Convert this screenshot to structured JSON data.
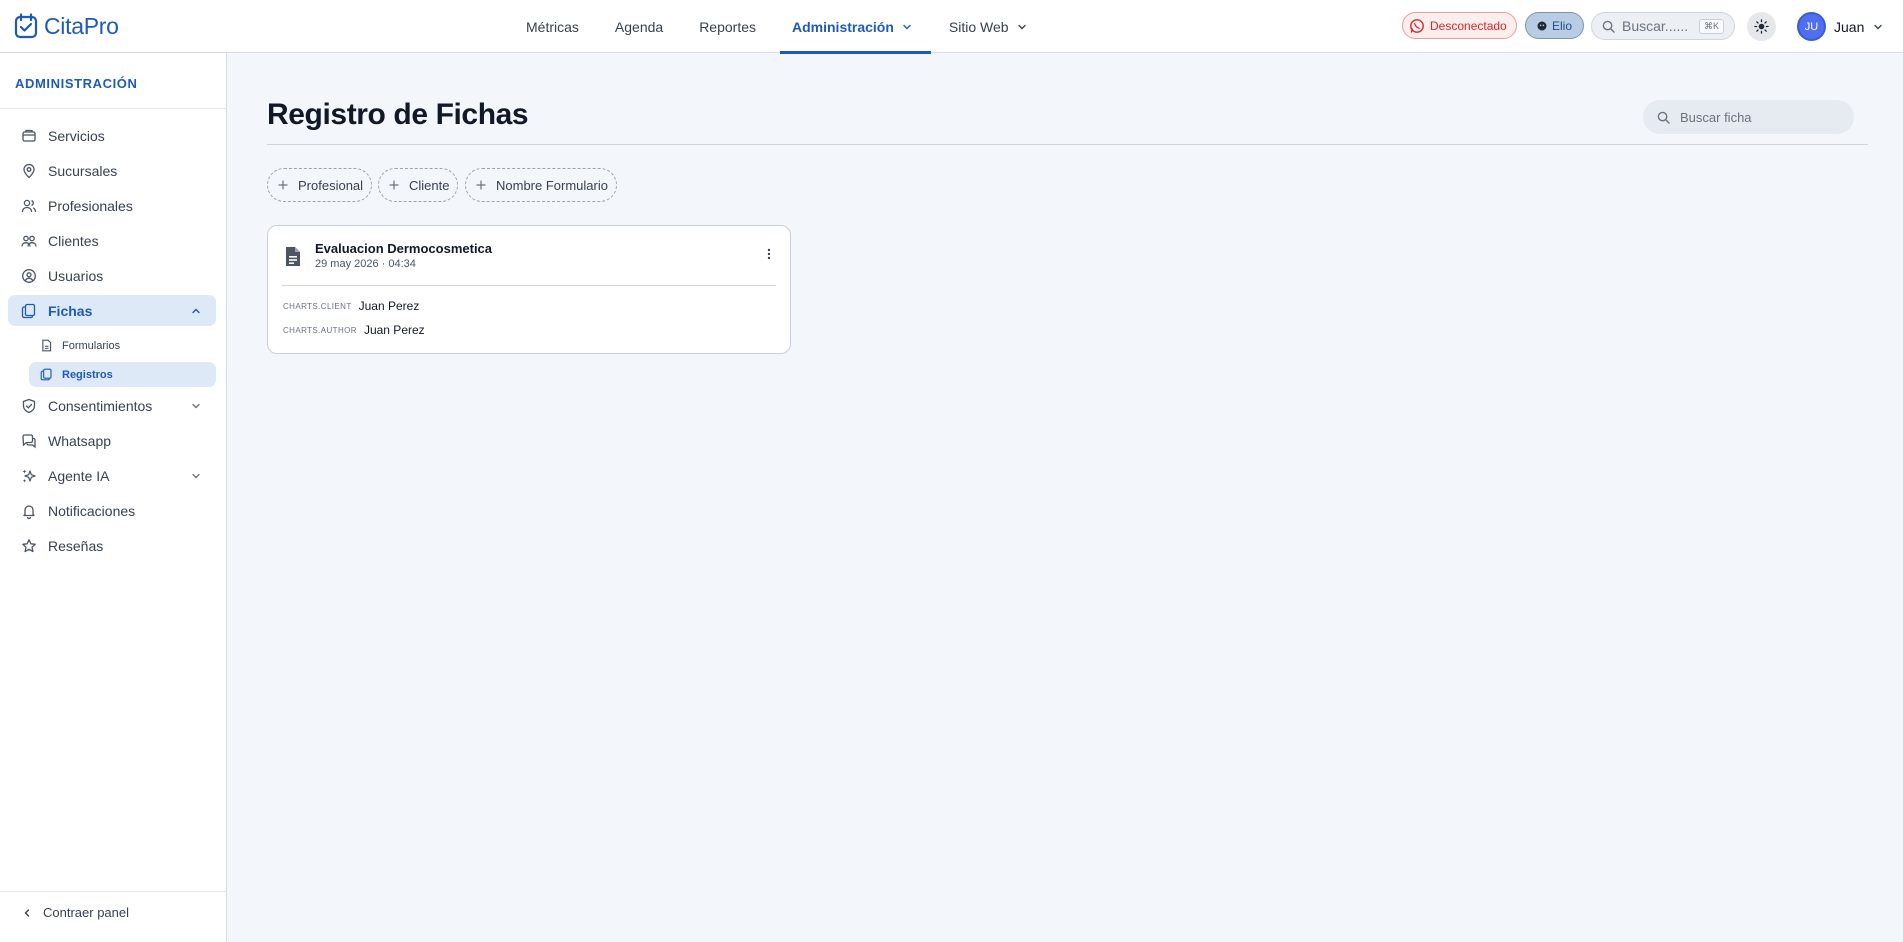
{
  "app": {
    "name": "CitaPro"
  },
  "nav": {
    "items": [
      {
        "label": "Métricas"
      },
      {
        "label": "Agenda"
      },
      {
        "label": "Reportes"
      },
      {
        "label": "Administración"
      },
      {
        "label": "Sitio Web"
      }
    ],
    "active": "Administración"
  },
  "header": {
    "whatsapp_status": "Desconectado",
    "assistant_label": "Elio",
    "search_placeholder": "Buscar......",
    "search_shortcut": "⌘K",
    "user_initials": "JU",
    "user_name": "Juan"
  },
  "sidebar": {
    "title": "ADMINISTRACIÓN",
    "items": [
      {
        "label": "Servicios",
        "icon": "box-icon"
      },
      {
        "label": "Sucursales",
        "icon": "location-icon"
      },
      {
        "label": "Profesionales",
        "icon": "users-icon"
      },
      {
        "label": "Clientes",
        "icon": "clients-icon"
      },
      {
        "label": "Usuarios",
        "icon": "user-circle-icon"
      },
      {
        "label": "Fichas",
        "icon": "files-icon",
        "active": true,
        "expanded": true
      },
      {
        "label": "Consentimientos",
        "icon": "shield-check-icon"
      },
      {
        "label": "Whatsapp",
        "icon": "chat-icon"
      },
      {
        "label": "Agente IA",
        "icon": "sparkles-icon"
      },
      {
        "label": "Notificaciones",
        "icon": "bell-icon"
      },
      {
        "label": "Reseñas",
        "icon": "star-icon"
      }
    ],
    "sub_items": [
      {
        "label": "Formularios",
        "icon": "file-icon"
      },
      {
        "label": "Registros",
        "icon": "files-icon",
        "active": true
      }
    ],
    "collapse_label": "Contraer panel"
  },
  "main": {
    "title": "Registro de Fichas",
    "search_placeholder": "Buscar ficha",
    "filters": [
      {
        "label": "Profesional"
      },
      {
        "label": "Cliente"
      },
      {
        "label": "Nombre Formulario"
      }
    ],
    "records": [
      {
        "title": "Evaluacion Dermocosmetica",
        "date": "29 may 2026 · 04:34",
        "fields": [
          {
            "key": "CHARTS.CLIENT",
            "value": "Juan Perez"
          },
          {
            "key": "CHARTS.AUTHOR",
            "value": "Juan Perez"
          }
        ]
      }
    ]
  },
  "colors": {
    "accent": "#1e5bb8",
    "background": "#f3f6fa",
    "active_bg": "#dde9f7",
    "danger": "#dc2626"
  }
}
